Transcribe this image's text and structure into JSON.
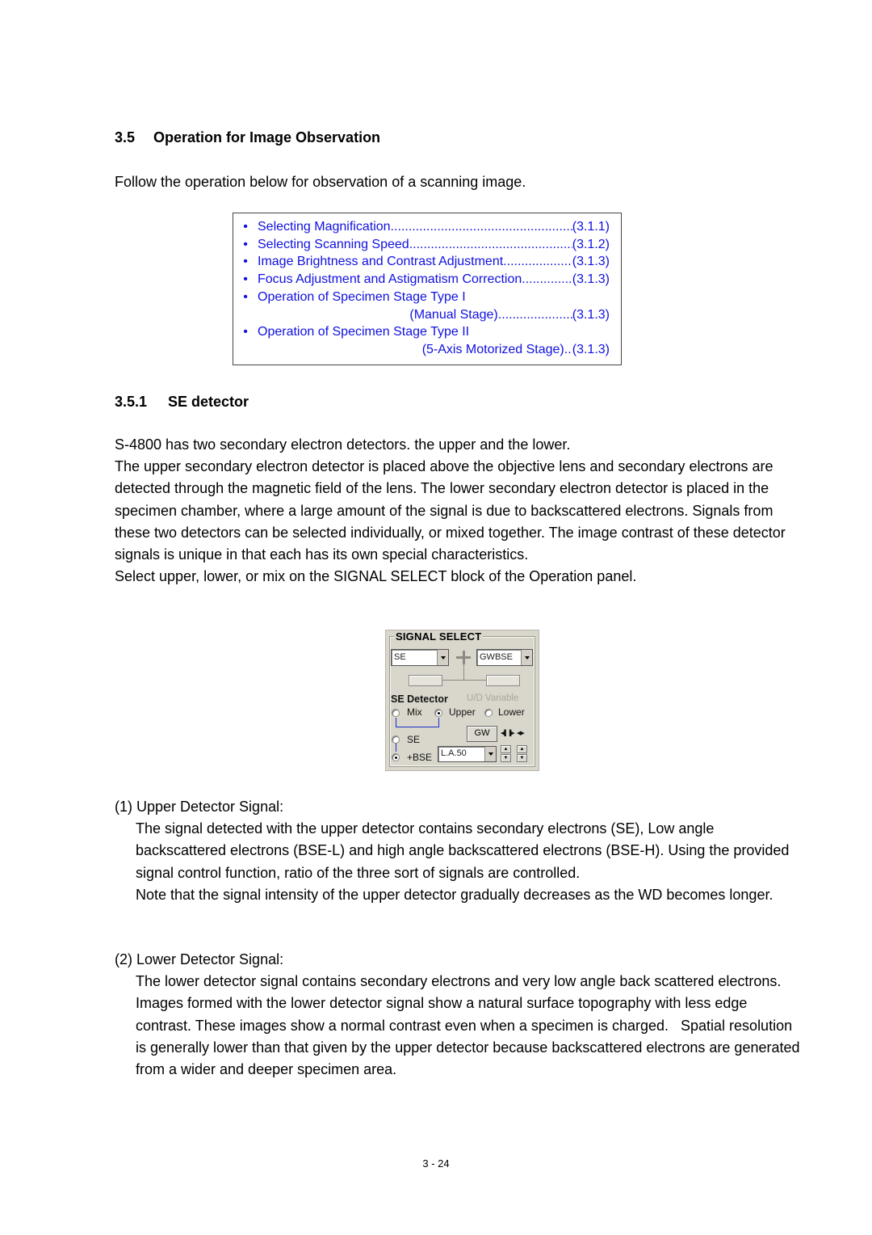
{
  "section": {
    "number": "3.5",
    "title": "Operation for Image Observation",
    "intro": "Follow the operation below for observation of a scanning image."
  },
  "toc": {
    "bullet": "•",
    "color": "#1010e0",
    "items": [
      {
        "label": "Selecting Magnification",
        "ref": "(3.1.1)"
      },
      {
        "label": "Selecting Scanning Speed",
        "ref": "(3.1.2)"
      },
      {
        "label": "Image Brightness and Contrast Adjustment",
        "ref": "(3.1.3)"
      },
      {
        "label": "Focus Adjustment and Astigmatism Correction",
        "ref": "(3.1.3)"
      },
      {
        "label": "Operation of Specimen Stage Type I",
        "sublabel": "(Manual Stage)",
        "ref": "(3.1.3)"
      },
      {
        "label": "Operation of Specimen Stage Type II",
        "sublabel": "(5-Axis Motorized Stage)",
        "ref": "(3.1.3)"
      }
    ]
  },
  "subsection": {
    "number": "3.5.1",
    "title": "SE detector",
    "paragraphs": [
      "S-4800 has two secondary electron detectors. the upper and the lower.",
      "The upper secondary electron detector is placed above the objective lens and secondary electrons are detected through the magnetic field of the lens. The lower secondary electron detector is placed in the specimen chamber, where a large amount of the signal is due to backscattered electrons. Signals from these two detectors can be selected individually, or mixed together. The image contrast of these detector signals is unique in that each has its own special characteristics.",
      "Select upper, lower, or mix on the SIGNAL SELECT block of the Operation panel."
    ]
  },
  "signal_panel": {
    "title": "SIGNAL SELECT",
    "left_select": "SE",
    "right_select": "GWBSE",
    "detector_label": "SE Detector",
    "ud_variable_label": "U/D Variable",
    "radios_detector": [
      {
        "label": "Mix",
        "selected": false
      },
      {
        "label": "Upper",
        "selected": true
      },
      {
        "label": "Lower",
        "selected": false
      }
    ],
    "radios_mode": [
      {
        "label": "SE",
        "selected": false
      },
      {
        "label": "+BSE",
        "selected": true
      }
    ],
    "gw_button": "GW",
    "la_select": "L.A.50",
    "arrow_glyphs_wide": "◀▌▐▶",
    "arrow_glyphs_narrow": "◀▶",
    "spin_up": "▲",
    "spin_down": "▼"
  },
  "items": [
    {
      "heading": "(1)  Upper Detector Signal:",
      "paragraphs": [
        "The signal detected with the upper detector contains secondary electrons (SE), Low angle backscattered electrons (BSE-L) and high angle backscattered electrons (BSE-H). Using the provided signal control function, ratio of the three sort of signals are controlled.",
        "Note that the signal intensity of the upper detector gradually decreases as the WD becomes longer."
      ]
    },
    {
      "heading": "(2) Lower Detector Signal:",
      "paragraphs": [
        "The lower detector signal contains secondary electrons and very low angle back scattered electrons. Images formed with the lower detector signal show a natural surface topography with less edge contrast. These images show a normal contrast even when a specimen is charged.   Spatial resolution is generally lower than that given by the upper detector because backscattered electrons are generated from a wider and deeper specimen area."
      ]
    }
  ],
  "footer": {
    "page_number": "3 - 24"
  }
}
